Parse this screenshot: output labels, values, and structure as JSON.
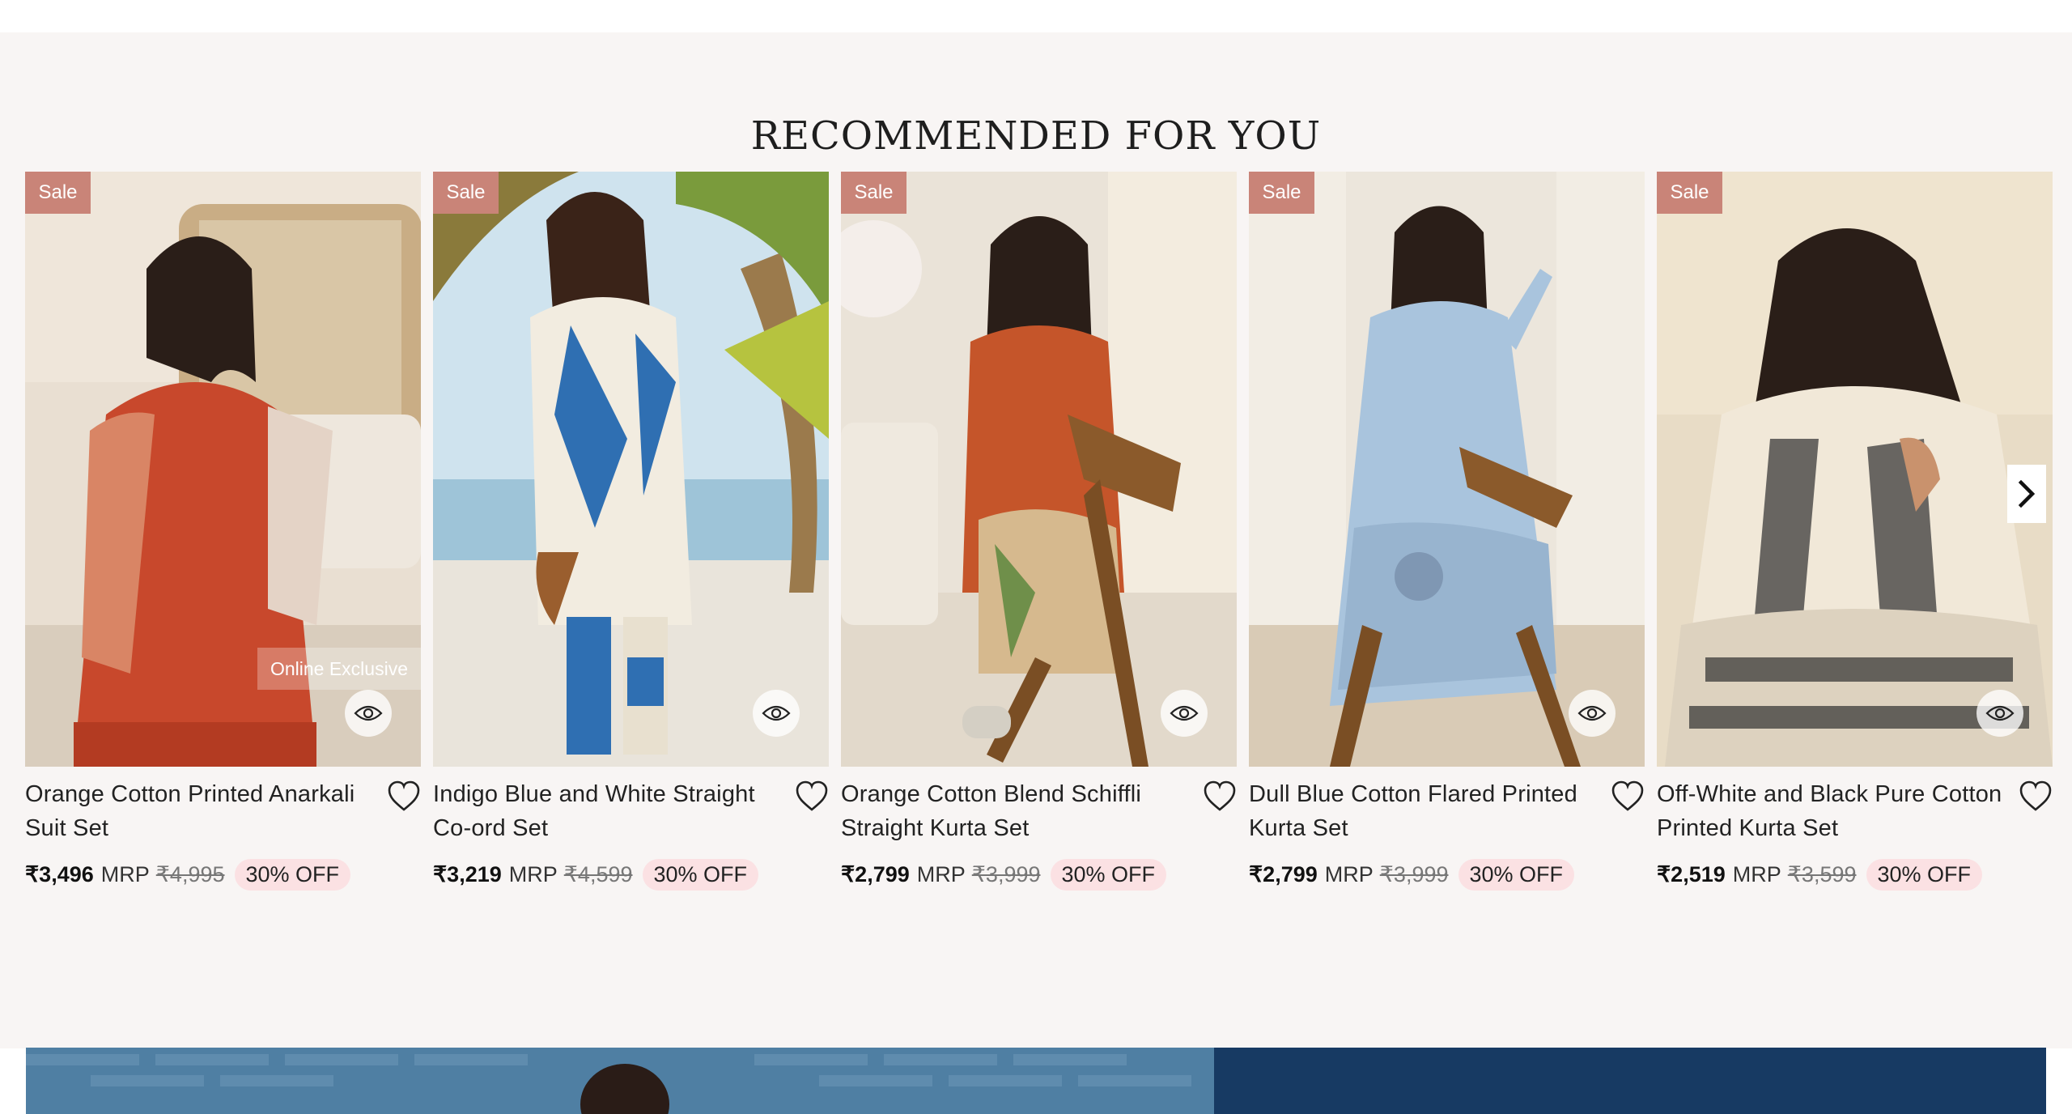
{
  "section": {
    "title": "RECOMMENDED FOR YOU"
  },
  "products": [
    {
      "badge": "Sale",
      "tag": "Online Exclusive",
      "name": "Orange Cotton Printed Anarkali Suit Set",
      "price": "₹3,496",
      "mrp_label": "MRP",
      "mrp": "₹4,995",
      "discount": "30% OFF"
    },
    {
      "badge": "Sale",
      "name": "Indigo Blue and White Straight Co-ord Set",
      "price": "₹3,219",
      "mrp_label": "MRP",
      "mrp": "₹4,599",
      "discount": "30% OFF"
    },
    {
      "badge": "Sale",
      "name": "Orange Cotton Blend Schiffli Straight Kurta Set",
      "price": "₹2,799",
      "mrp_label": "MRP",
      "mrp": "₹3,999",
      "discount": "30% OFF"
    },
    {
      "badge": "Sale",
      "name": "Dull Blue Cotton Flared Printed Kurta Set",
      "price": "₹2,799",
      "mrp_label": "MRP",
      "mrp": "₹3,999",
      "discount": "30% OFF"
    },
    {
      "badge": "Sale",
      "name": "Off-White and Black Pure Cotton Printed Kurta Set",
      "price": "₹2,519",
      "mrp_label": "MRP",
      "mrp": "₹3,599",
      "discount": "30% OFF"
    }
  ],
  "colors": {
    "section_bg": "#f8f5f4",
    "sale_badge": "#c98478",
    "discount_pill": "#fbe1e3",
    "banner_left": "#4f7fa3",
    "banner_right": "#173a63"
  },
  "icons": {
    "quick_view": "eye-icon",
    "wishlist": "heart-icon",
    "next": "chevron-right-icon"
  }
}
